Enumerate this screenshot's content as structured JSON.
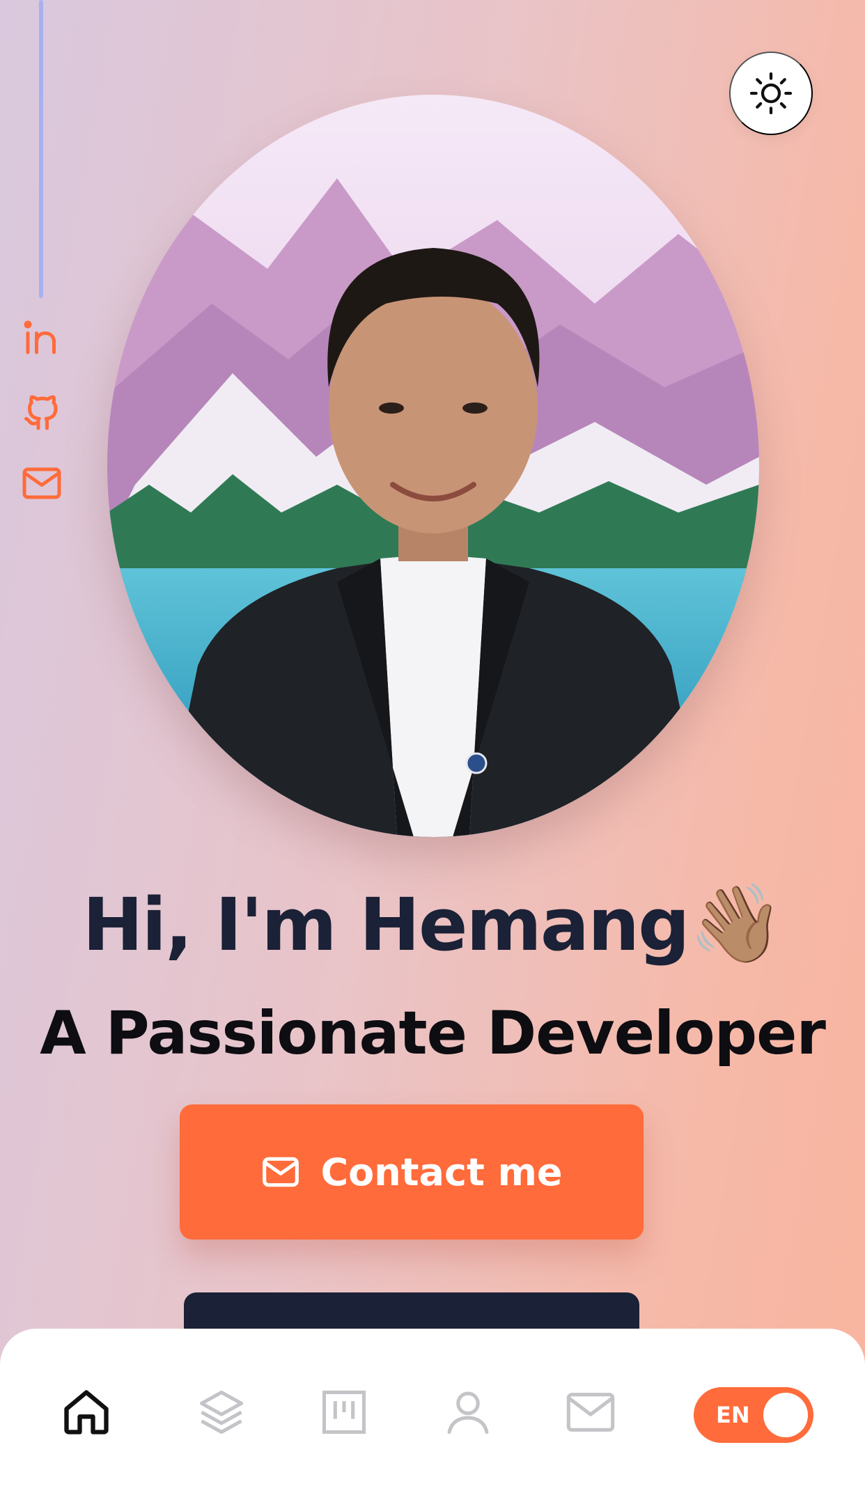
{
  "hero": {
    "greeting": "Hi, I'm Hemang",
    "wave_emoji": "👋🏽",
    "subtitle": "A Passionate Developer",
    "contact_label": "Contact me"
  },
  "socials": {
    "icons": [
      "linkedin-icon",
      "github-icon",
      "mail-icon"
    ]
  },
  "header": {
    "theme_icon": "sun-icon"
  },
  "bottom_nav": {
    "items": [
      "home-icon",
      "layers-icon",
      "projects-icon",
      "user-icon",
      "mail-icon"
    ],
    "active": "home-icon",
    "language": "EN"
  },
  "colors": {
    "accent": "#ff6b3a",
    "dark": "#1b2136",
    "side_line": "#a8b0ef"
  }
}
